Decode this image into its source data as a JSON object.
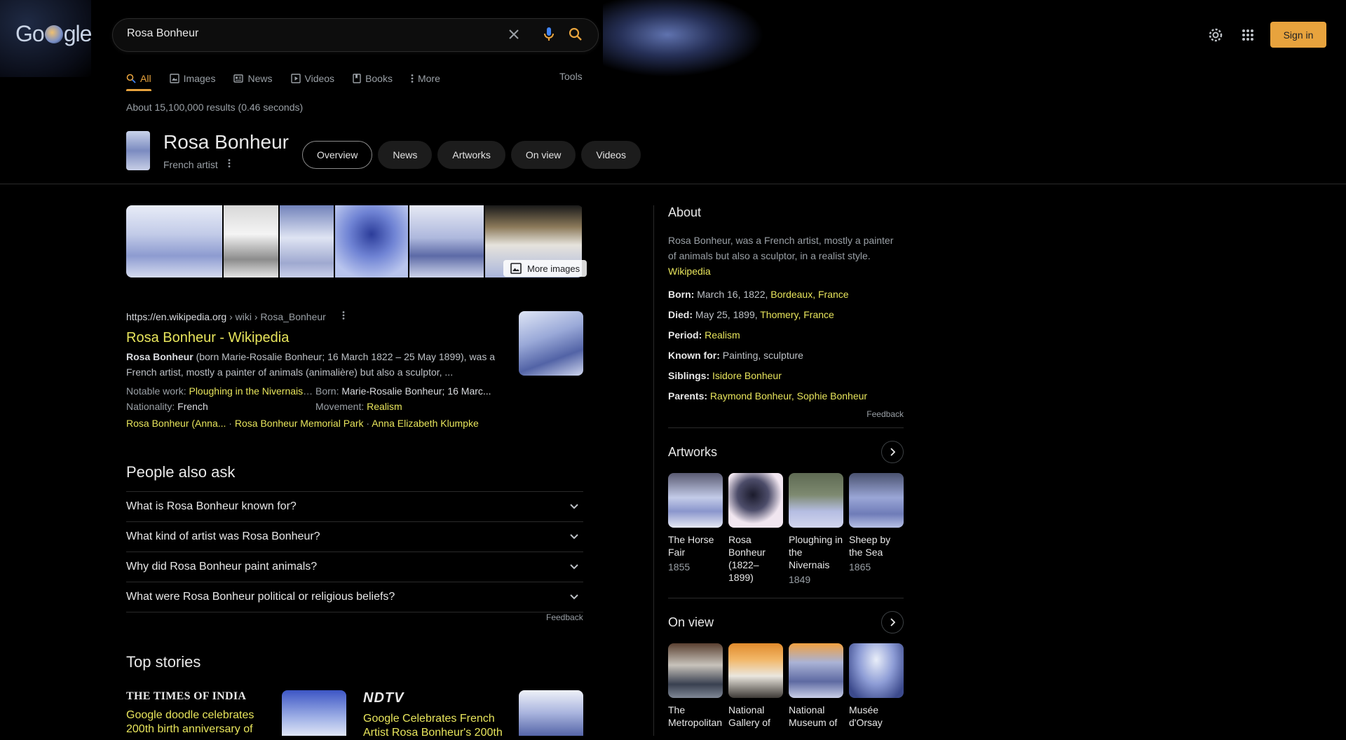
{
  "header": {
    "logo_text_left": "Go",
    "logo_text_right": "gle",
    "search_query": "Rosa Bonheur",
    "sign_in_label": "Sign in",
    "icons": [
      "close-icon",
      "microphone-icon",
      "search-icon",
      "gear-icon",
      "apps-grid-icon"
    ]
  },
  "tabs": {
    "items": [
      {
        "label": "All",
        "icon": "search-icon",
        "active": true
      },
      {
        "label": "Images",
        "icon": "image-icon"
      },
      {
        "label": "News",
        "icon": "news-icon"
      },
      {
        "label": "Videos",
        "icon": "play-icon"
      },
      {
        "label": "Books",
        "icon": "book-icon"
      },
      {
        "label": "More",
        "icon": "dots-vertical-icon"
      }
    ],
    "tools_label": "Tools"
  },
  "result_stats": "About 15,100,000 results (0.46 seconds)",
  "entity": {
    "title": "Rosa Bonheur",
    "subtitle": "French artist",
    "chips": [
      "Overview",
      "News",
      "Artworks",
      "On view",
      "Videos"
    ]
  },
  "images": {
    "more_label": "More images"
  },
  "result": {
    "cite_domain": "https://en.wikipedia.org",
    "cite_path": " › wiki › Rosa_Bonheur",
    "title": "Rosa Bonheur - Wikipedia",
    "snippet_bold": "Rosa Bonheur",
    "snippet_rest": " (born Marie-Rosalie Bonheur; 16 March 1822 – 25 May 1899), was a French artist, mostly a painter of animals (animalière) but also a sculptor, ...",
    "facts": {
      "notable_label": "Notable work: ",
      "notable_value": "Ploughing in the Nivernais, ...",
      "born_label": "Born: ",
      "born_value": "Marie-Rosalie Bonheur; 16 Marc...",
      "nationality_label": "Nationality: ",
      "nationality_value": "French",
      "movement_label": "Movement: ",
      "movement_value": "Realism"
    },
    "sitelinks": [
      "Rosa Bonheur (Anna...",
      "Rosa Bonheur Memorial Park",
      "Anna Elizabeth Klumpke"
    ],
    "sitelink_sep": " · "
  },
  "people_also_ask": {
    "title": "People also ask",
    "questions": [
      "What is Rosa Bonheur known for?",
      "What kind of artist was Rosa Bonheur?",
      "Why did Rosa Bonheur paint animals?",
      "What were Rosa Bonheur political or religious beliefs?"
    ],
    "feedback": "Feedback"
  },
  "top_stories": {
    "title": "Top stories",
    "stories": [
      {
        "publisher": "THE TIMES OF INDIA",
        "headline": "Google doodle celebrates 200th birth anniversary of"
      },
      {
        "publisher": "NDTV",
        "headline": "Google Celebrates French Artist Rosa Bonheur's 200th"
      }
    ]
  },
  "knowledge_panel": {
    "about_title": "About",
    "description": "Rosa Bonheur, was a French artist, mostly a painter of animals but also a sculptor, in a realist style.",
    "source": "Wikipedia",
    "born_label": "Born:",
    "born_value": " March 16, 1822, ",
    "born_place": "Bordeaux, France",
    "died_label": "Died:",
    "died_value": " May 25, 1899, ",
    "died_place": "Thomery, France",
    "period_label": "Period:",
    "period_value": "Realism",
    "known_label": "Known for:",
    "known_value": " Painting, sculpture",
    "siblings_label": "Siblings:",
    "siblings_value": "Isidore Bonheur",
    "parents_label": "Parents:",
    "parents_value": "Raymond Bonheur, Sophie Bonheur",
    "feedback": "Feedback",
    "artworks_title": "Artworks",
    "artworks": [
      {
        "name": "The Horse Fair",
        "year": "1855"
      },
      {
        "name": "Rosa Bonheur (1822–1899)",
        "year": ""
      },
      {
        "name": "Ploughing in the Nivernais",
        "year": "1849"
      },
      {
        "name": "Sheep by the Sea",
        "year": "1865"
      }
    ],
    "on_view_title": "On view",
    "on_view": [
      {
        "name": "The Metropolitan"
      },
      {
        "name": "National Gallery of"
      },
      {
        "name": "National Museum of"
      },
      {
        "name": "Musée d'Orsay"
      }
    ]
  }
}
